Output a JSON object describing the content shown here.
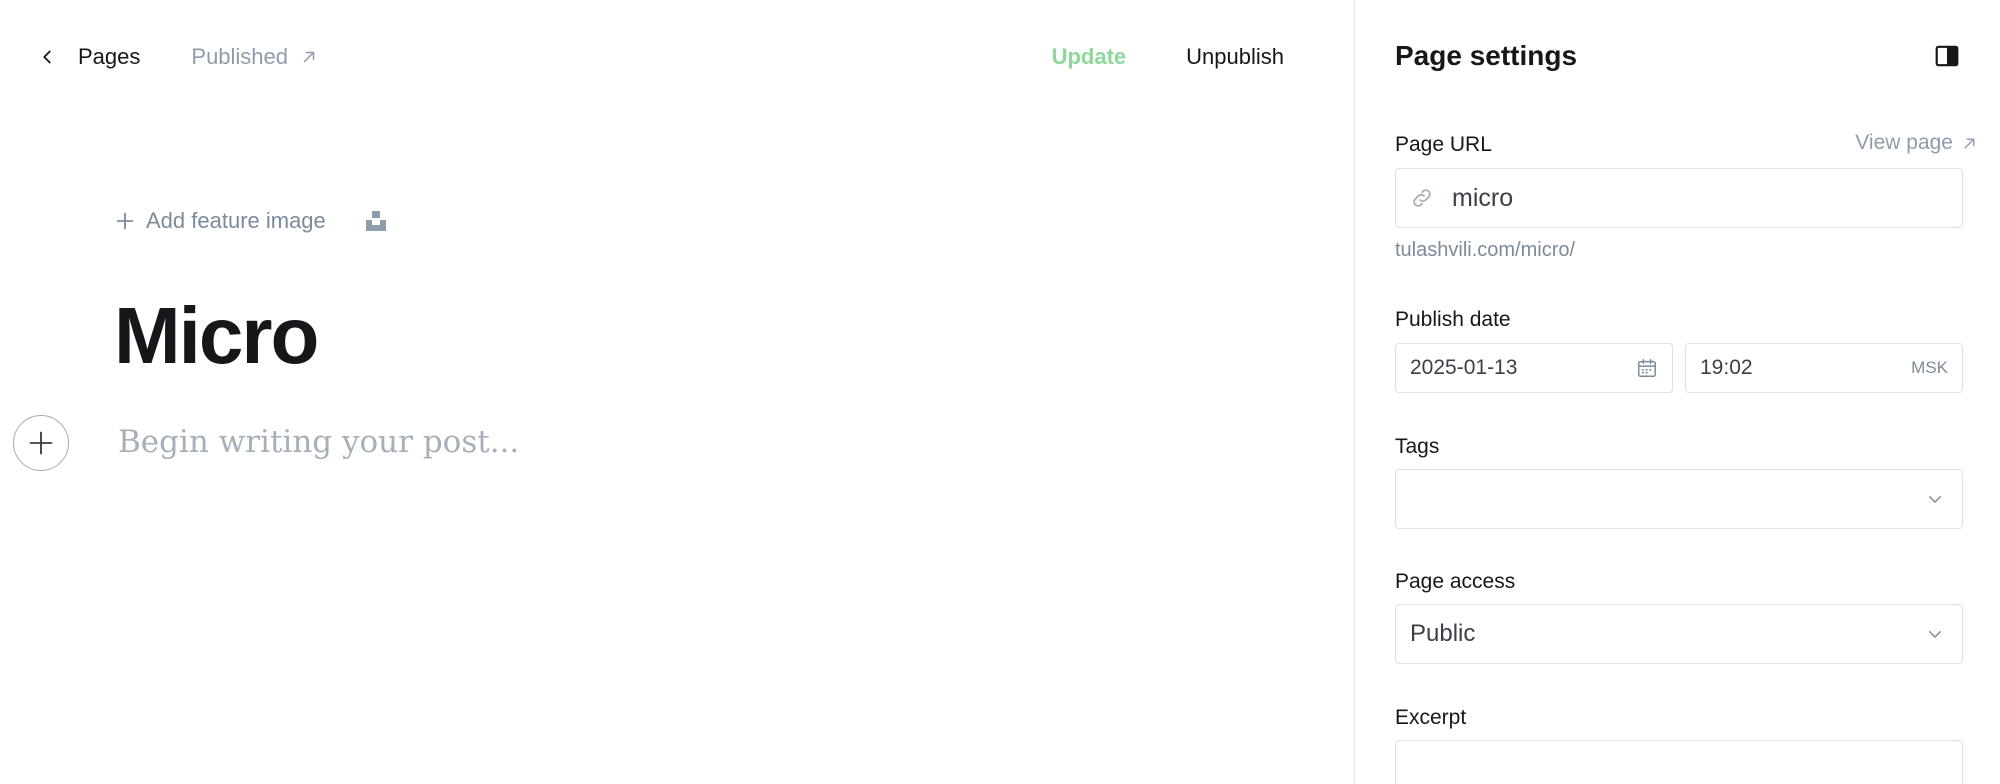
{
  "topbar": {
    "back_label": "Pages",
    "status_label": "Published",
    "update_label": "Update",
    "unpublish_label": "Unpublish"
  },
  "editor": {
    "add_feature_image_label": "Add feature image",
    "title": "Micro",
    "body_placeholder": "Begin writing your post..."
  },
  "settings": {
    "title": "Page settings",
    "page_url_label": "Page URL",
    "view_page_label": "View page",
    "slug": "micro",
    "url_hint": "tulashvili.com/micro/",
    "publish_date_label": "Publish date",
    "date": "2025-01-13",
    "time": "19:02",
    "timezone": "MSK",
    "tags_label": "Tags",
    "page_access_label": "Page access",
    "page_access_value": "Public",
    "excerpt_label": "Excerpt"
  },
  "colors": {
    "update_accent": "#8ed79a",
    "muted_text": "#8e9cac",
    "border": "#dde1e5"
  },
  "icons": [
    "chevron-left-icon",
    "arrow-up-right-icon",
    "plus-icon",
    "unsplash-icon",
    "plus-circle-icon",
    "sidebar-toggle-icon",
    "link-icon",
    "calendar-icon",
    "chevron-down-icon"
  ]
}
